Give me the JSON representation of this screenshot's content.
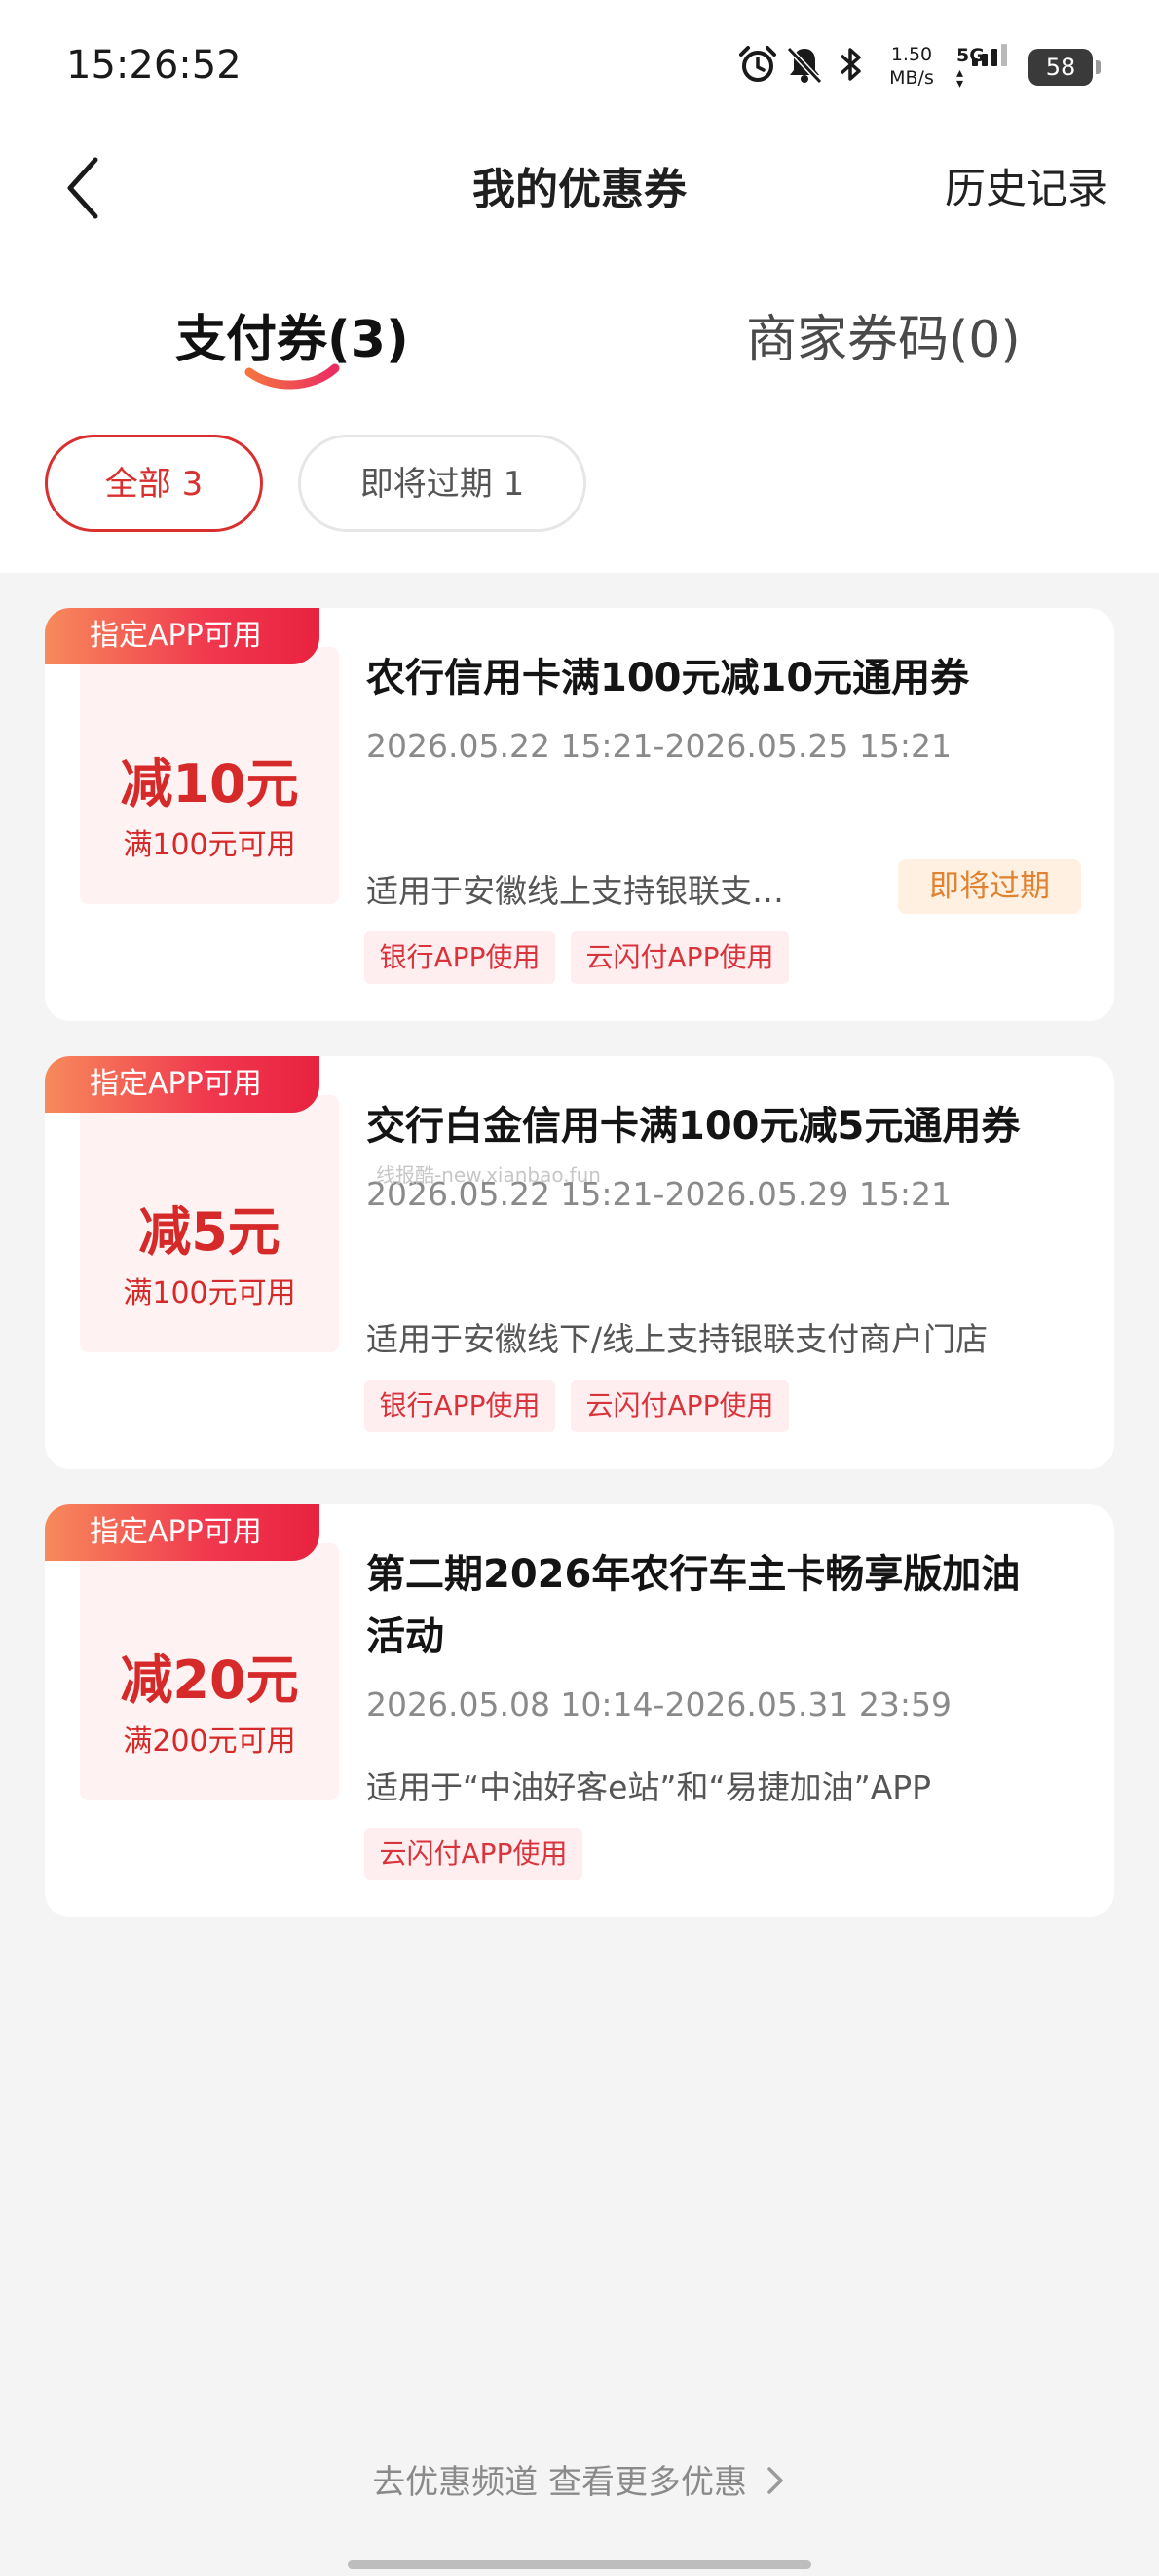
{
  "status_bar": {
    "time": "15:26:52",
    "speed_value": "1.50",
    "speed_unit": "MB/s",
    "network": "5G",
    "battery": "58"
  },
  "nav": {
    "title": "我的优惠券",
    "history": "历史记录"
  },
  "tabs": [
    {
      "label": "支付券(3)",
      "active": true
    },
    {
      "label": "商家券码(0)",
      "active": false
    }
  ],
  "filters": [
    {
      "label": "全部 3",
      "active": true
    },
    {
      "label": "即将过期 1",
      "active": false
    }
  ],
  "coupons": [
    {
      "tag": "指定APP可用",
      "amount": "减10元",
      "condition": "满100元可用",
      "title": "农行信用卡满100元减10元通用券",
      "validity": "2026.05.22  15:21-2026.05.25  15:21",
      "description": "适用于安徽线上支持银联支…",
      "status": "即将过期",
      "channels": [
        "银行APP使用",
        "云闪付APP使用"
      ]
    },
    {
      "tag": "指定APP可用",
      "amount": "减5元",
      "condition": "满100元可用",
      "title": "交行白金信用卡满100元减5元通用券",
      "validity": "2026.05.22  15:21-2026.05.29  15:21",
      "description": "适用于安徽线下/线上支持银联支付商户门店",
      "channels": [
        "银行APP使用",
        "云闪付APP使用"
      ]
    },
    {
      "tag": "指定APP可用",
      "amount": "减20元",
      "condition": "满200元可用",
      "title_line1": "第二期2026年农行车主卡畅享版加油",
      "title_line2": "活动",
      "validity": "2026.05.08  10:14-2026.05.31  23:59",
      "description": "适用于“中油好客e站”和“易捷加油”APP",
      "channels": [
        "云闪付APP使用"
      ]
    }
  ],
  "watermark": "线报酷-new.xianbao.fun",
  "footer": {
    "link": "去优惠频道 查看更多优惠"
  },
  "colors": {
    "accent": "#d8302e",
    "tag_gradient_start": "#f78a5b",
    "tag_gradient_end": "#e8223f",
    "expire_text": "#e0822f"
  }
}
